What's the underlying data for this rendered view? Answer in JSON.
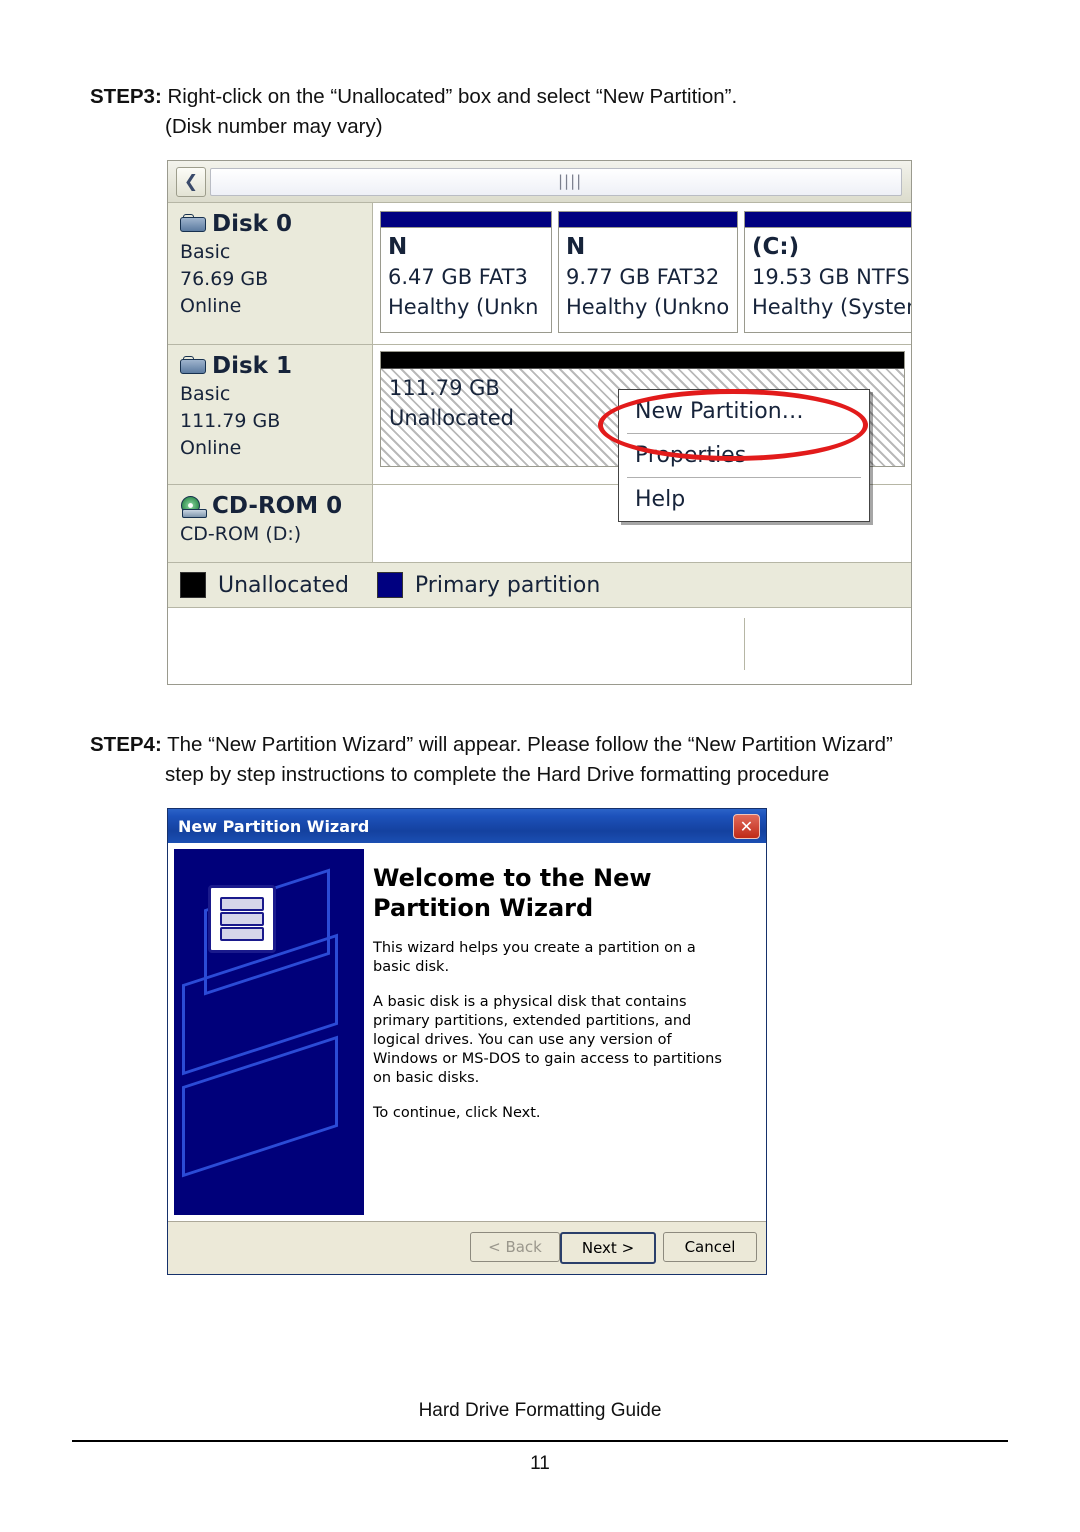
{
  "steps": {
    "step3": {
      "label": "STEP3:",
      "line1": " Right-click on the “Unallocated” box and select “New Partition”.",
      "line2": "(Disk number may vary)"
    },
    "step4": {
      "label": "STEP4:",
      "line1": " The “New Partition Wizard” will appear. Please follow the “New Partition Wizard”",
      "line2": "step by step instructions to complete the Hard Drive formatting procedure"
    }
  },
  "disk_management": {
    "back_icon": "❮",
    "grip_icon": "||||",
    "disks": [
      {
        "name": "Disk 0",
        "type": "Basic",
        "size": "76.69 GB",
        "status": "Online",
        "icon": "hard-disk-icon",
        "volumes": [
          {
            "name": "N",
            "size_fs": "6.47 GB FAT3",
            "health": "Healthy (Unkn"
          },
          {
            "name": "N",
            "size_fs": "9.77 GB FAT32",
            "health": "Healthy (Unkno"
          },
          {
            "name": "(C:)",
            "size_fs": "19.53 GB NTFS",
            "health": "Healthy (System"
          }
        ]
      },
      {
        "name": "Disk 1",
        "type": "Basic",
        "size": "111.79 GB",
        "status": "Online",
        "icon": "hard-disk-icon",
        "unallocated": {
          "size": "111.79 GB",
          "label": "Unallocated"
        }
      },
      {
        "name": "CD-ROM 0",
        "type": "CD-ROM (D:)",
        "icon": "cd-rom-icon"
      }
    ],
    "context_menu": [
      {
        "label": "New Partition…",
        "highlighted": true
      },
      {
        "label": "Properties",
        "highlighted": false
      },
      {
        "label": "Help",
        "highlighted": false
      }
    ],
    "legend": [
      {
        "swatch": "black",
        "label": "Unallocated",
        "color": "#000000"
      },
      {
        "swatch": "blue",
        "label": "Primary partition",
        "color": "#000080"
      }
    ],
    "highlight_color": "#e21b1b"
  },
  "wizard": {
    "title": "New Partition Wizard",
    "close_icon": "✕",
    "heading": "Welcome to the New Partition Wizard",
    "paragraphs": [
      "This wizard helps you create a partition on a basic disk.",
      "A basic disk is a physical disk that contains primary partitions, extended partitions, and logical drives. You can use any version of Windows or MS-DOS to gain access to partitions on basic disks.",
      "To continue, click Next."
    ],
    "buttons": {
      "back": "< Back",
      "back_accel": "B",
      "next": "Next >",
      "next_accel": "N",
      "cancel": "Cancel"
    }
  },
  "footer": {
    "text": "Hard Drive Formatting Guide",
    "page": "11"
  }
}
